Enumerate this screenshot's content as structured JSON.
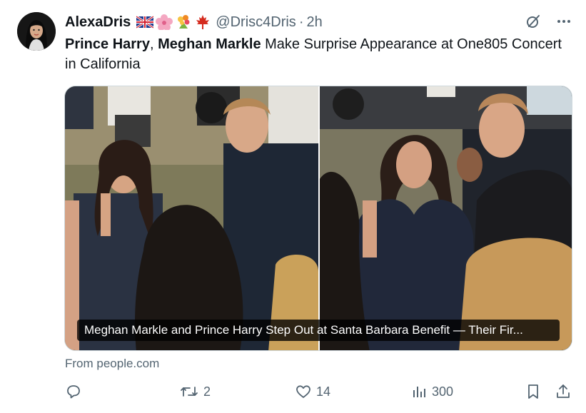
{
  "author": {
    "name": "AlexaDris",
    "flag_emojis": [
      "uk-flag",
      "cherry-blossom",
      "bouquet",
      "maple-leaf"
    ],
    "handle": "@Drisc4Dris",
    "separator": "·",
    "time": "2h"
  },
  "tweet": {
    "bold_part_1": "Prince Harry",
    "sep": ", ",
    "bold_part_2": "Meghan Markle",
    "rest": " Make Surprise Appearance at One805 Concert in California"
  },
  "media": {
    "caption": "Meghan Markle and Prince Harry Step Out at Santa Barbara Benefit — Their Fir..."
  },
  "source": "From people.com",
  "actions": {
    "reply_count": "",
    "retweet_count": "2",
    "like_count": "14",
    "views_count": "300"
  },
  "colors": {
    "text": "#0f1419",
    "muted": "#536471",
    "border": "#cfd9de"
  }
}
